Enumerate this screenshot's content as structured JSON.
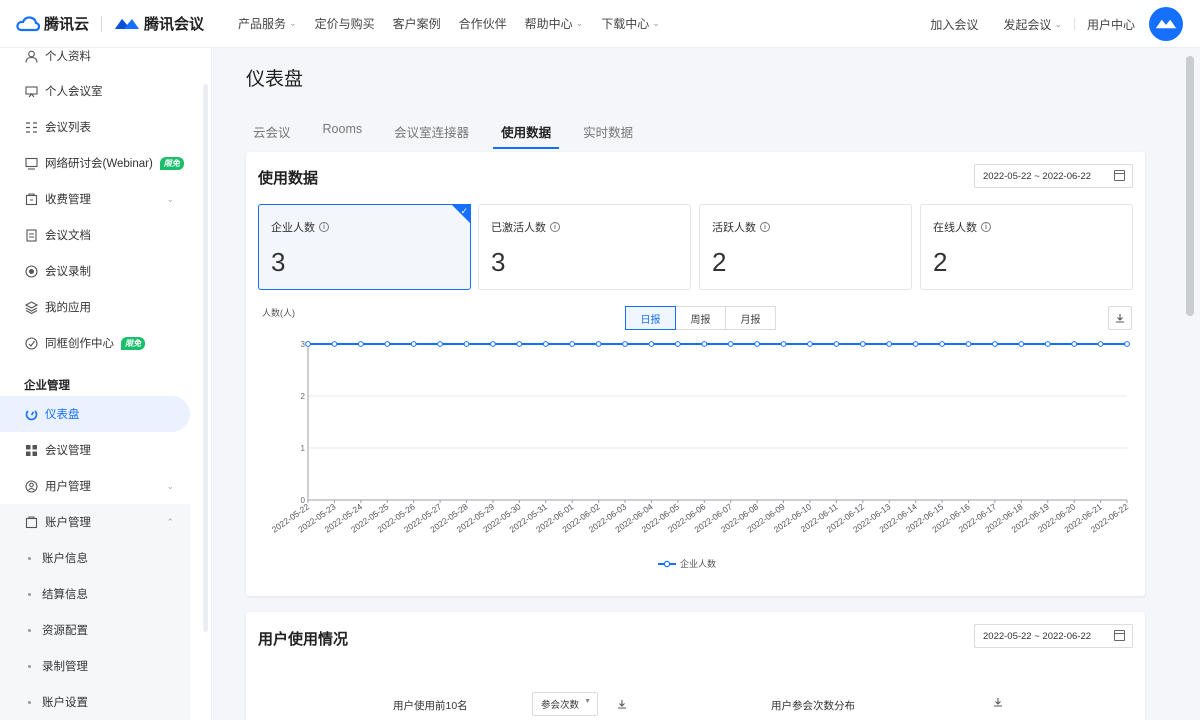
{
  "header": {
    "brand_cloud": "腾讯云",
    "brand_meeting": "腾讯会议",
    "nav": [
      {
        "label": "产品服务",
        "dropdown": true
      },
      {
        "label": "定价与购买",
        "dropdown": false
      },
      {
        "label": "客户案例",
        "dropdown": false
      },
      {
        "label": "合作伙伴",
        "dropdown": false
      },
      {
        "label": "帮助中心",
        "dropdown": true
      },
      {
        "label": "下载中心",
        "dropdown": true
      }
    ],
    "right": {
      "join": "加入会议",
      "start": "发起会议",
      "user_center": "用户中心"
    }
  },
  "sidebar": {
    "items": [
      {
        "label": "个人资料",
        "icon": "user-icon"
      },
      {
        "label": "个人会议室",
        "icon": "meeting-room-icon"
      },
      {
        "label": "会议列表",
        "icon": "list-icon"
      },
      {
        "label": "网络研讨会(Webinar)",
        "icon": "webinar-icon",
        "badge": "限免"
      },
      {
        "label": "收费管理",
        "icon": "billing-icon",
        "chevron": true
      },
      {
        "label": "会议文档",
        "icon": "document-icon"
      },
      {
        "label": "会议录制",
        "icon": "record-icon"
      },
      {
        "label": "我的应用",
        "icon": "apps-icon"
      },
      {
        "label": "同框创作中心",
        "icon": "create-icon",
        "badge": "限免"
      }
    ],
    "section_title": "企业管理",
    "admin_items": [
      {
        "label": "仪表盘",
        "icon": "dashboard-icon",
        "active": true
      },
      {
        "label": "会议管理",
        "icon": "grid-icon"
      },
      {
        "label": "用户管理",
        "icon": "users-icon",
        "chevron": true
      },
      {
        "label": "账户管理",
        "icon": "account-icon",
        "chevron": true
      }
    ],
    "account_sub": [
      "账户信息",
      "结算信息",
      "资源配置",
      "录制管理",
      "账户设置"
    ]
  },
  "main": {
    "page_title": "仪表盘",
    "tabs": [
      {
        "label": "云会议",
        "active": false
      },
      {
        "label": "Rooms",
        "active": false
      },
      {
        "label": "会议室连接器",
        "active": false
      },
      {
        "label": "使用数据",
        "active": true
      },
      {
        "label": "实时数据",
        "active": false
      }
    ],
    "usage": {
      "title": "使用数据",
      "date_range": "2022-05-22 ~ 2022-06-22",
      "stats": [
        {
          "label": "企业人数",
          "value": "3",
          "selected": true
        },
        {
          "label": "已激活人数",
          "value": "3",
          "selected": false
        },
        {
          "label": "活跃人数",
          "value": "2",
          "selected": false
        },
        {
          "label": "在线人数",
          "value": "2",
          "selected": false
        }
      ],
      "period_buttons": [
        {
          "label": "日报",
          "active": true
        },
        {
          "label": "周报",
          "active": false
        },
        {
          "label": "月报",
          "active": false
        }
      ]
    },
    "user_usage": {
      "title": "用户使用情况",
      "date_range": "2022-05-22 ~ 2022-06-22",
      "top10_label": "用户使用前10名",
      "select_value": "参会次数",
      "distribution_label": "用户参会次数分布"
    }
  },
  "chart_data": {
    "type": "line",
    "ylabel": "人数(人)",
    "ylim": [
      0,
      3
    ],
    "yticks": [
      0,
      1,
      2,
      3
    ],
    "x": [
      "2022-05-22",
      "2022-05-23",
      "2022-05-24",
      "2022-05-25",
      "2022-05-26",
      "2022-05-27",
      "2022-05-28",
      "2022-05-29",
      "2022-05-30",
      "2022-05-31",
      "2022-06-01",
      "2022-06-02",
      "2022-06-03",
      "2022-06-04",
      "2022-06-05",
      "2022-06-06",
      "2022-06-07",
      "2022-06-08",
      "2022-06-09",
      "2022-06-10",
      "2022-06-11",
      "2022-06-12",
      "2022-06-13",
      "2022-06-14",
      "2022-06-15",
      "2022-06-16",
      "2022-06-17",
      "2022-06-18",
      "2022-06-19",
      "2022-06-20",
      "2022-06-21",
      "2022-06-22"
    ],
    "series": [
      {
        "name": "企业人数",
        "values": [
          3,
          3,
          3,
          3,
          3,
          3,
          3,
          3,
          3,
          3,
          3,
          3,
          3,
          3,
          3,
          3,
          3,
          3,
          3,
          3,
          3,
          3,
          3,
          3,
          3,
          3,
          3,
          3,
          3,
          3,
          3,
          3
        ]
      }
    ],
    "grid": true,
    "legend": "bottom",
    "color": "#1670ff"
  }
}
